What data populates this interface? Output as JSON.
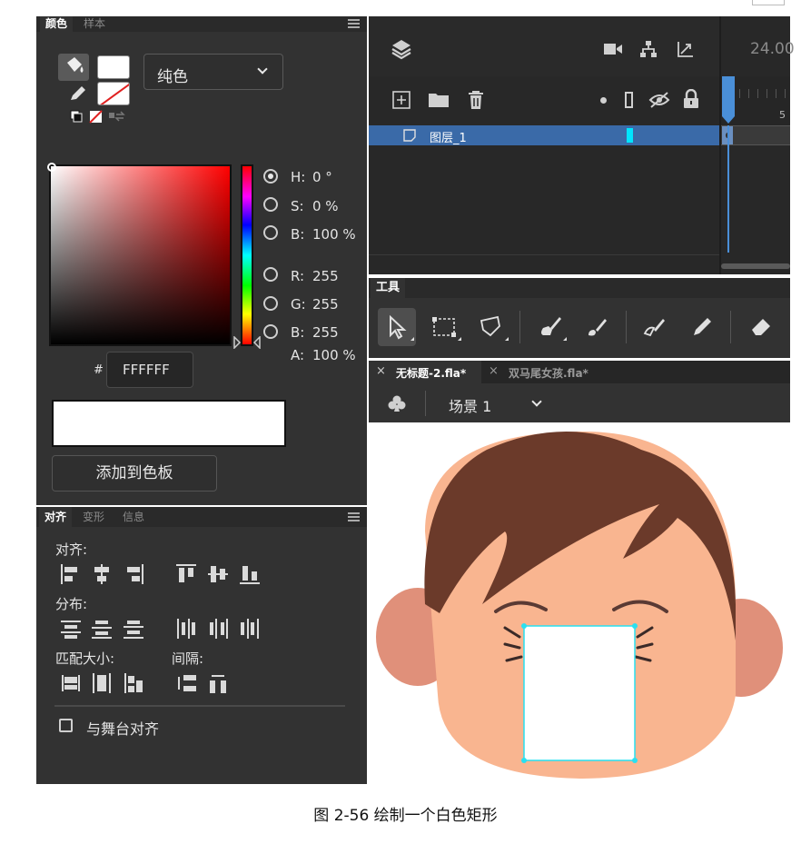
{
  "color_panel": {
    "tabs": [
      "颜色",
      "样本"
    ],
    "fill_type": "纯色",
    "hsb": {
      "h_label": "H:",
      "h_value": "0 °",
      "s_label": "S:",
      "s_value": "0 %",
      "b_label": "B:",
      "b_value": "100 %"
    },
    "rgb": {
      "r_label": "R:",
      "r_value": "255",
      "g_label": "G:",
      "g_value": "255",
      "b_label": "B:",
      "b_value": "255"
    },
    "alpha": {
      "label": "A:",
      "value": "100 %"
    },
    "hex_prefix": "#",
    "hex_value": "FFFFFF",
    "add_button": "添加到色板",
    "current_color": "#ffffff"
  },
  "align_panel": {
    "tabs": [
      "对齐",
      "变形",
      "信息"
    ],
    "sections": {
      "align": "对齐:",
      "distribute": "分布:",
      "match_size": "匹配大小:",
      "spacing": "间隔:"
    },
    "stage_align_label": "与舞台对齐",
    "stage_align_checked": false
  },
  "timeline": {
    "fps": "24.00",
    "frame_marker": "5",
    "layer_name": "图层_1",
    "layer_color": "#00e5ff"
  },
  "tools_panel": {
    "title": "工具"
  },
  "documents": {
    "tabs": [
      {
        "close": "×",
        "name": "无标题-2.fla*",
        "active": true
      },
      {
        "close": "×",
        "name": "双马尾女孩.fla*",
        "active": false
      }
    ],
    "scene": "场景 1"
  },
  "stage": {
    "hair_color": "#6b3a2a",
    "skin_color": "#f9b590",
    "ear_color": "#e0907a",
    "selection_color": "#29e0f0"
  },
  "caption": "图 2-56 绘制一个白色矩形"
}
